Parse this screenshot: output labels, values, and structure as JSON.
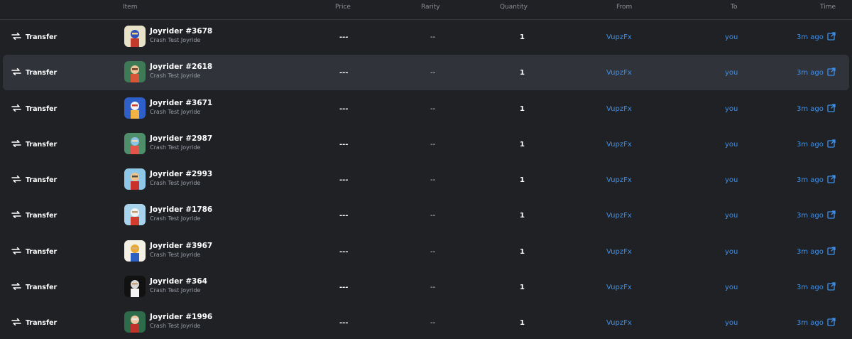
{
  "headers": {
    "item": "Item",
    "price": "Price",
    "rarity": "Rarity",
    "quantity": "Quantity",
    "from": "From",
    "to": "To",
    "time": "Time"
  },
  "colors": {
    "background": "#1f2125",
    "row_hover": "#30333a",
    "link": "#3f8fe8",
    "text": "#ffffff",
    "muted": "#9ba0a8"
  },
  "rows": [
    {
      "event": "Transfer",
      "event_icon": "transfer-arrows-icon",
      "name": "Joyrider #3678",
      "collection": "Crash Test Joyride",
      "price": "---",
      "rarity": "--",
      "quantity": "1",
      "from": "VupzFx",
      "to": "you",
      "time": "3m ago",
      "time_icon": "external-link-icon"
    },
    {
      "event": "Transfer",
      "event_icon": "transfer-arrows-icon",
      "name": "Joyrider #2618",
      "collection": "Crash Test Joyride",
      "price": "---",
      "rarity": "--",
      "quantity": "1",
      "from": "VupzFx",
      "to": "you",
      "time": "3m ago",
      "time_icon": "external-link-icon"
    },
    {
      "event": "Transfer",
      "event_icon": "transfer-arrows-icon",
      "name": "Joyrider #3671",
      "collection": "Crash Test Joyride",
      "price": "---",
      "rarity": "--",
      "quantity": "1",
      "from": "VupzFx",
      "to": "you",
      "time": "3m ago",
      "time_icon": "external-link-icon"
    },
    {
      "event": "Transfer",
      "event_icon": "transfer-arrows-icon",
      "name": "Joyrider #2987",
      "collection": "Crash Test Joyride",
      "price": "---",
      "rarity": "--",
      "quantity": "1",
      "from": "VupzFx",
      "to": "you",
      "time": "3m ago",
      "time_icon": "external-link-icon"
    },
    {
      "event": "Transfer",
      "event_icon": "transfer-arrows-icon",
      "name": "Joyrider #2993",
      "collection": "Crash Test Joyride",
      "price": "---",
      "rarity": "--",
      "quantity": "1",
      "from": "VupzFx",
      "to": "you",
      "time": "3m ago",
      "time_icon": "external-link-icon"
    },
    {
      "event": "Transfer",
      "event_icon": "transfer-arrows-icon",
      "name": "Joyrider #1786",
      "collection": "Crash Test Joyride",
      "price": "---",
      "rarity": "--",
      "quantity": "1",
      "from": "VupzFx",
      "to": "you",
      "time": "3m ago",
      "time_icon": "external-link-icon"
    },
    {
      "event": "Transfer",
      "event_icon": "transfer-arrows-icon",
      "name": "Joyrider #3967",
      "collection": "Crash Test Joyride",
      "price": "---",
      "rarity": "--",
      "quantity": "1",
      "from": "VupzFx",
      "to": "you",
      "time": "3m ago",
      "time_icon": "external-link-icon"
    },
    {
      "event": "Transfer",
      "event_icon": "transfer-arrows-icon",
      "name": "Joyrider #364",
      "collection": "Crash Test Joyride",
      "price": "---",
      "rarity": "--",
      "quantity": "1",
      "from": "VupzFx",
      "to": "you",
      "time": "3m ago",
      "time_icon": "external-link-icon"
    },
    {
      "event": "Transfer",
      "event_icon": "transfer-arrows-icon",
      "name": "Joyrider #1996",
      "collection": "Crash Test Joyride",
      "price": "---",
      "rarity": "--",
      "quantity": "1",
      "from": "VupzFx",
      "to": "you",
      "time": "3m ago",
      "time_icon": "external-link-icon"
    }
  ]
}
